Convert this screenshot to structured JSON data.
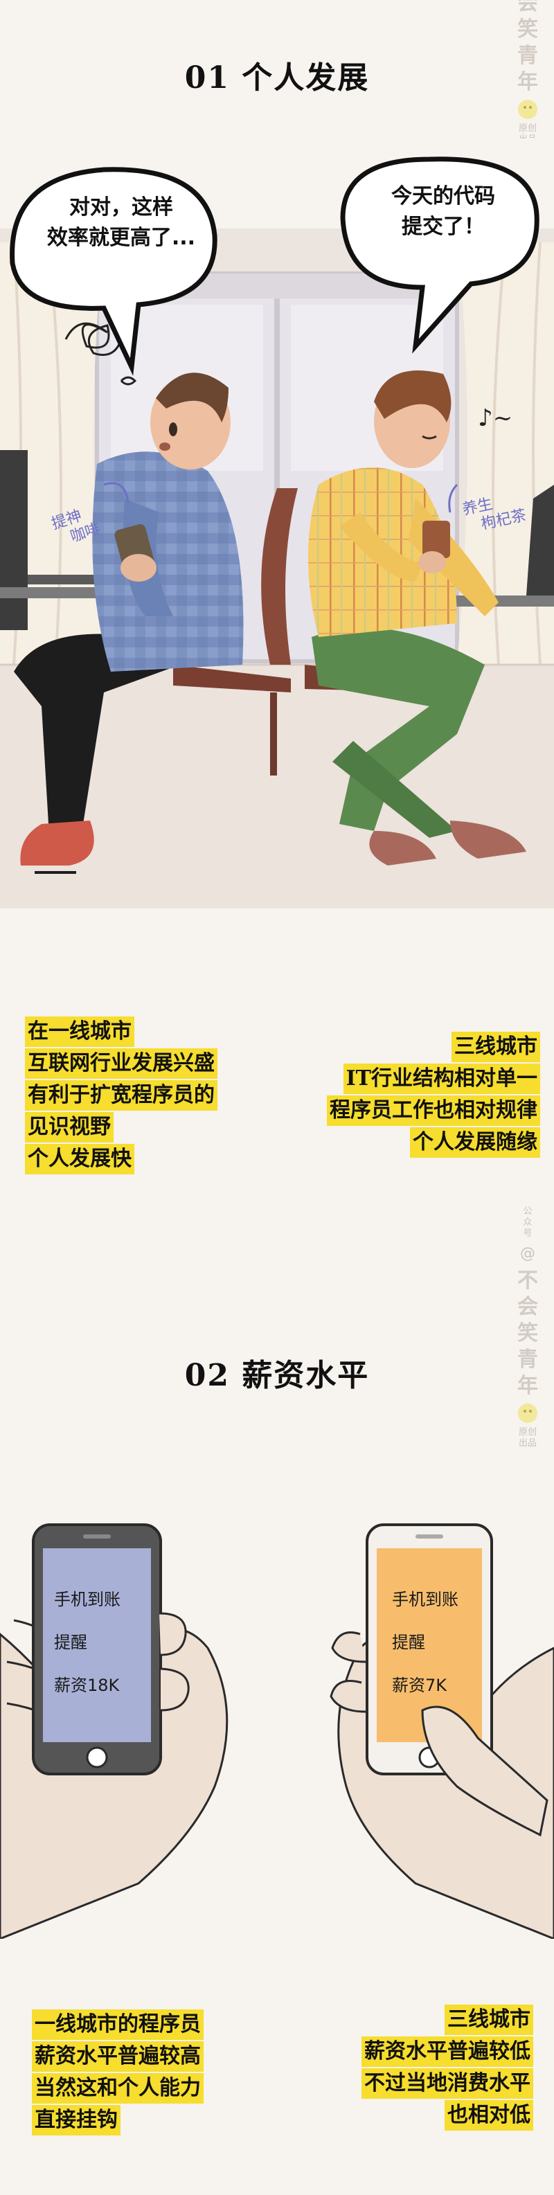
{
  "section1": {
    "title": "01 个人发展",
    "bubble_left": [
      "对对，这样",
      "效率就更高了..."
    ],
    "bubble_right": [
      "今天的代码",
      "提交了！"
    ],
    "note_left": [
      "提神",
      "咖啡"
    ],
    "note_right": [
      "养生",
      "枸杞茶"
    ],
    "caption_left": [
      "在一线城市",
      "互联网行业发展兴盛",
      "有利于扩宽程序员的",
      "见识视野",
      "个人发展快"
    ],
    "caption_right": [
      "三线城市",
      "IT行业结构相对单一",
      "程序员工作也相对规律",
      "个人发展随缘"
    ]
  },
  "section2": {
    "title": "02 薪资水平",
    "phone_left": [
      "手机到账",
      "提醒",
      "薪资18K"
    ],
    "phone_right": [
      "手机到账",
      "提醒",
      "薪资7K"
    ],
    "caption_left": [
      "一线城市的程序员",
      "薪资水平普遍较高",
      "当然这和个人能力",
      "直接挂钩"
    ],
    "caption_right": [
      "三线城市",
      "薪资水平普遍较低",
      "不过当地消费水平",
      "也相对低"
    ]
  },
  "watermark": {
    "top": [
      "会",
      "笑",
      "青",
      "年"
    ],
    "top_small": [
      "原创",
      "出品"
    ],
    "mid_small": [
      "公",
      "众",
      "号"
    ],
    "mid": [
      "不",
      "会",
      "笑",
      "青",
      "年"
    ],
    "mid_bottom": [
      "原创",
      "出品"
    ]
  },
  "colors": {
    "highlight": "#f6dd2e",
    "phone_left_screen": "#a8b0d6",
    "phone_right_screen": "#f7bd6c",
    "background": "#f7f3ef"
  }
}
